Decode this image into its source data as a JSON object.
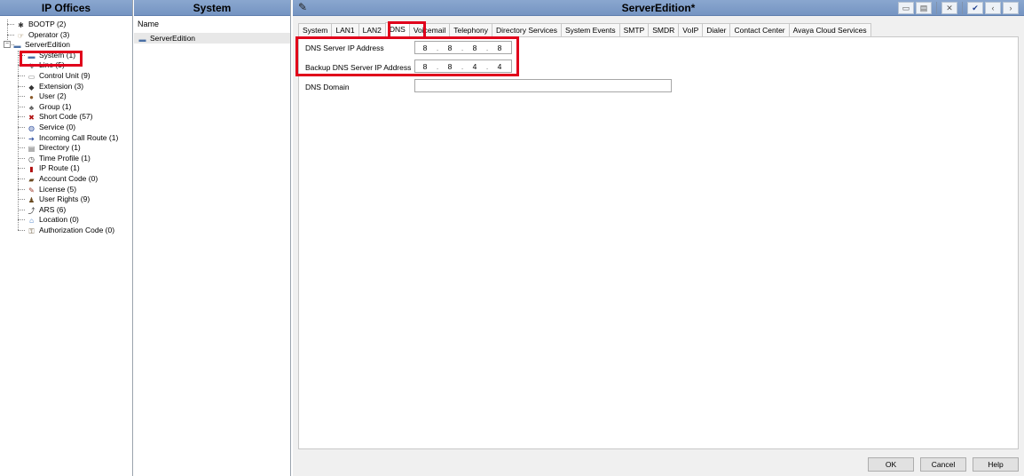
{
  "left_panel": {
    "title": "IP Offices",
    "tree": [
      {
        "label": "BOOTP (2)",
        "icon": "bootp-icon",
        "glyph": "✱",
        "level": 1
      },
      {
        "label": "Operator (3)",
        "icon": "operator-icon",
        "glyph": "☞",
        "level": 1
      },
      {
        "label": "ServerEdition",
        "icon": "server-icon",
        "glyph": "▬",
        "level": 0,
        "expander": "−"
      },
      {
        "label": "System (1)",
        "icon": "system-icon",
        "glyph": "▬",
        "level": 2
      },
      {
        "label": "Line (5)",
        "icon": "line-icon",
        "glyph": "↯",
        "level": 2
      },
      {
        "label": "Control Unit (9)",
        "icon": "control-unit-icon",
        "glyph": "▭",
        "level": 2
      },
      {
        "label": "Extension (3)",
        "icon": "extension-icon",
        "glyph": "◆",
        "level": 2
      },
      {
        "label": "User (2)",
        "icon": "user-icon",
        "glyph": "●",
        "level": 2
      },
      {
        "label": "Group (1)",
        "icon": "group-icon",
        "glyph": "♣",
        "level": 2
      },
      {
        "label": "Short Code (57)",
        "icon": "short-code-icon",
        "glyph": "✖",
        "level": 2
      },
      {
        "label": "Service (0)",
        "icon": "service-icon",
        "glyph": "◍",
        "level": 2
      },
      {
        "label": "Incoming Call Route (1)",
        "icon": "incoming-call-route-icon",
        "glyph": "➔",
        "level": 2
      },
      {
        "label": "Directory (1)",
        "icon": "directory-icon",
        "glyph": "▤",
        "level": 2
      },
      {
        "label": "Time Profile (1)",
        "icon": "time-profile-icon",
        "glyph": "◷",
        "level": 2
      },
      {
        "label": "IP Route (1)",
        "icon": "ip-route-icon",
        "glyph": "▮",
        "level": 2
      },
      {
        "label": "Account Code (0)",
        "icon": "account-code-icon",
        "glyph": "▰",
        "level": 2
      },
      {
        "label": "License (5)",
        "icon": "license-icon",
        "glyph": "✎",
        "level": 2
      },
      {
        "label": "User Rights (9)",
        "icon": "user-rights-icon",
        "glyph": "♟",
        "level": 2
      },
      {
        "label": "ARS (6)",
        "icon": "ars-icon",
        "glyph": "⤴",
        "level": 2
      },
      {
        "label": "Location (0)",
        "icon": "location-icon",
        "glyph": "⌂",
        "level": 2
      },
      {
        "label": "Authorization Code (0)",
        "icon": "authorization-code-icon",
        "glyph": "⚿",
        "level": 2
      }
    ]
  },
  "middle_panel": {
    "title": "System",
    "column_header": "Name",
    "rows": [
      {
        "label": "ServerEdition",
        "icon": "server-icon",
        "glyph": "▬"
      }
    ]
  },
  "editor": {
    "title": "ServerEdition*",
    "toolbar": {
      "new": "▭",
      "save": "▤",
      "delete": "✕",
      "validate": "✔",
      "prev": "‹",
      "next": "›"
    },
    "tabs": [
      "System",
      "LAN1",
      "LAN2",
      "DNS",
      "Voicemail",
      "Telephony",
      "Directory Services",
      "System Events",
      "SMTP",
      "SMDR",
      "VoIP",
      "Dialer",
      "Contact Center",
      "Avaya Cloud Services"
    ],
    "active_tab": "DNS",
    "fields": {
      "dns_server_label": "DNS Server IP Address",
      "dns_server_octets": [
        "8",
        "8",
        "8",
        "8"
      ],
      "backup_dns_label": "Backup DNS Server IP Address",
      "backup_dns_octets": [
        "8",
        "8",
        "4",
        "4"
      ],
      "dns_domain_label": "DNS Domain",
      "dns_domain_value": ""
    },
    "buttons": {
      "ok": "OK",
      "cancel": "Cancel",
      "help": "Help"
    }
  },
  "colors": {
    "header": "#7d9bc8",
    "highlight": "#e0001b",
    "toolbar_check": "#1f3f8f"
  }
}
